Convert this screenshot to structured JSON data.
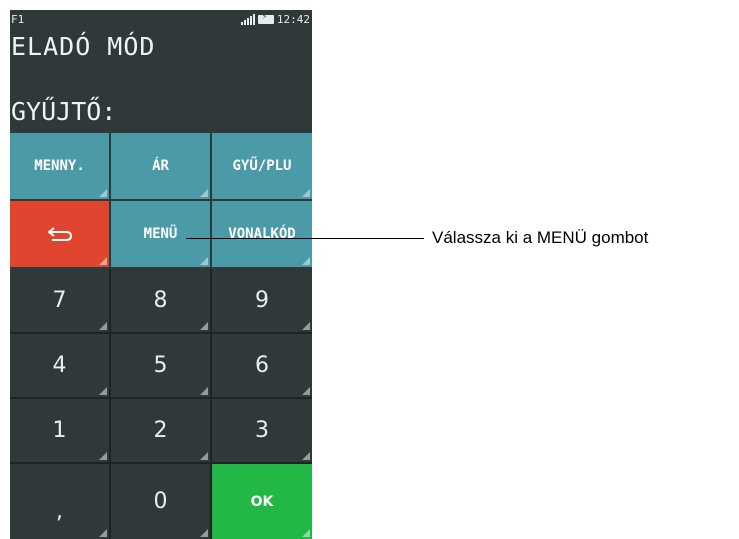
{
  "status": {
    "function_key": "F1",
    "time": "12:42"
  },
  "mode_title": "ELADÓ MÓD",
  "collector_label": "GYŰJTŐ:",
  "keys": {
    "quantity": "MENNY.",
    "price": "ÁR",
    "collector_plu": "GYŰ/PLU",
    "back_icon": "back-arrow-icon",
    "menu": "MENÜ",
    "barcode": "VONALKÓD",
    "n7": "7",
    "n8": "8",
    "n9": "9",
    "n4": "4",
    "n5": "5",
    "n6": "6",
    "n1": "1",
    "n2": "2",
    "n3": "3",
    "comma": ",",
    "n0": "0",
    "ok": "OK"
  },
  "colors": {
    "function_key": "#4a9aa7",
    "back_key": "#e0452f",
    "ok_key": "#23b846",
    "screen": "#2f3939"
  },
  "callout": "Válassza ki a MENÜ gombot"
}
